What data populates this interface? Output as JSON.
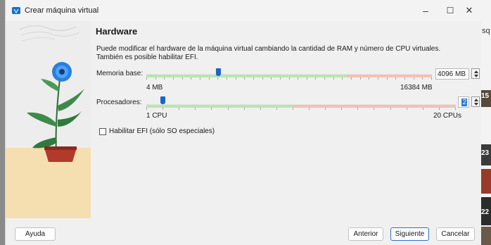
{
  "window": {
    "title": "Crear máquina virtual"
  },
  "titlebar": {
    "minimize_glyph": "–",
    "maximize_glyph": "☐",
    "close_glyph": "✕"
  },
  "page": {
    "heading": "Hardware",
    "description": "Puede modificar el hardware de la máquina virtual cambiando la cantidad de RAM y número de CPU virtuales. También es posible habilitar EFI."
  },
  "memory": {
    "label": "Memoria base:",
    "min_label": "4 MB",
    "max_label": "16384 MB",
    "value": "4096 MB",
    "slider_fraction": 0.25
  },
  "processors": {
    "label": "Procesadores:",
    "min_label": "1 CPU",
    "max_label": "20 CPUs",
    "value": "2",
    "slider_fraction": 0.053
  },
  "efi": {
    "label": "Habilitar EFI (sólo SO especiales)",
    "checked": false
  },
  "footer": {
    "help_label": "Ayuda",
    "back_label": "Anterior",
    "next_label": "Siguiente",
    "cancel_label": "Cancelar"
  },
  "background": {
    "top_text": "sq",
    "badge_1": "15",
    "badge_2": "23",
    "badge_3": "22"
  },
  "colors": {
    "accent": "#1f64c8",
    "slider_ok": "#b9e6ac",
    "slider_warn": "#f5c0b4"
  }
}
